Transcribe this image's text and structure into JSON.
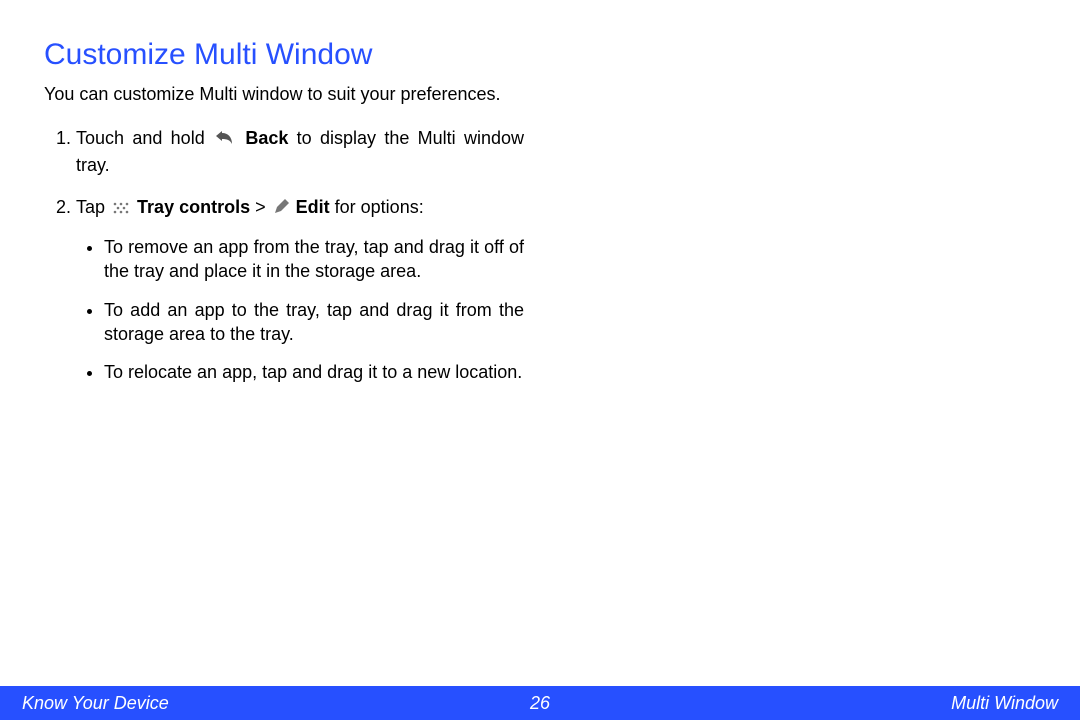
{
  "title": "Customize Multi Window",
  "intro": "You can customize Multi window to suit your preferences.",
  "step1": {
    "pre": "Touch and hold ",
    "bold": "Back",
    "post": " to display the Multi window tray."
  },
  "step2": {
    "pre": "Tap ",
    "bold1": "Tray controls",
    "sep": " > ",
    "bold2": "Edit",
    "post": " for options:"
  },
  "sub": {
    "a": "To remove an app from the tray, tap and drag it off of the tray and place it in the storage area.",
    "b": "To add an app to the tray, tap and drag it from the storage area to the tray.",
    "c": "To relocate an app, tap and drag it to a new location."
  },
  "footer": {
    "left": "Know Your Device",
    "center": "26",
    "right": "Multi Window"
  }
}
